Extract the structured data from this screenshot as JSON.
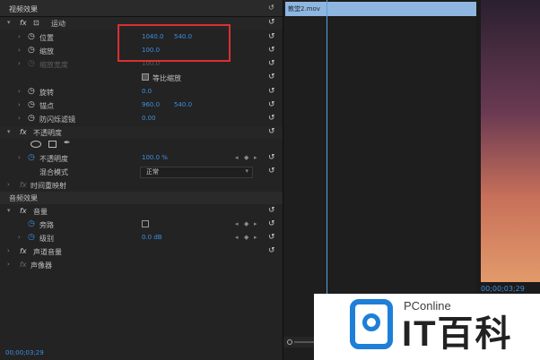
{
  "panel": {
    "title": "视频效果",
    "audio_title": "音频效果"
  },
  "motion": {
    "name": "运动",
    "position": {
      "label": "位置",
      "x": "1040.0",
      "y": "540.0"
    },
    "scale": {
      "label": "缩放",
      "value": "100.0"
    },
    "scale_width": {
      "label": "缩放宽度",
      "value": "100.0"
    },
    "uniform_scale": {
      "label": "等比缩放",
      "checked": true
    },
    "rotation": {
      "label": "旋转",
      "value": "0.0"
    },
    "anchor": {
      "label": "锚点",
      "x": "960.0",
      "y": "540.0"
    },
    "antiflicker": {
      "label": "防闪烁滤镜",
      "value": "0.00"
    }
  },
  "opacity": {
    "name": "不透明度",
    "opacity": {
      "label": "不透明度",
      "value": "100.0 %"
    },
    "blend": {
      "label": "混合模式",
      "value": "正常"
    }
  },
  "time_remap": {
    "name": "时间重映射"
  },
  "volume": {
    "name": "音量",
    "bypass": {
      "label": "旁路"
    },
    "level": {
      "label": "级别",
      "value": "0.0 dB"
    }
  },
  "channel_volume": {
    "name": "声道音量"
  },
  "panner": {
    "name": "声像器"
  },
  "timeline": {
    "clip_name": "教堂2.mov"
  },
  "timecode": {
    "left": "00;00;03;29",
    "right": "00;00;03;29"
  },
  "watermark": {
    "brand": "PConline",
    "text": "IT百科"
  }
}
